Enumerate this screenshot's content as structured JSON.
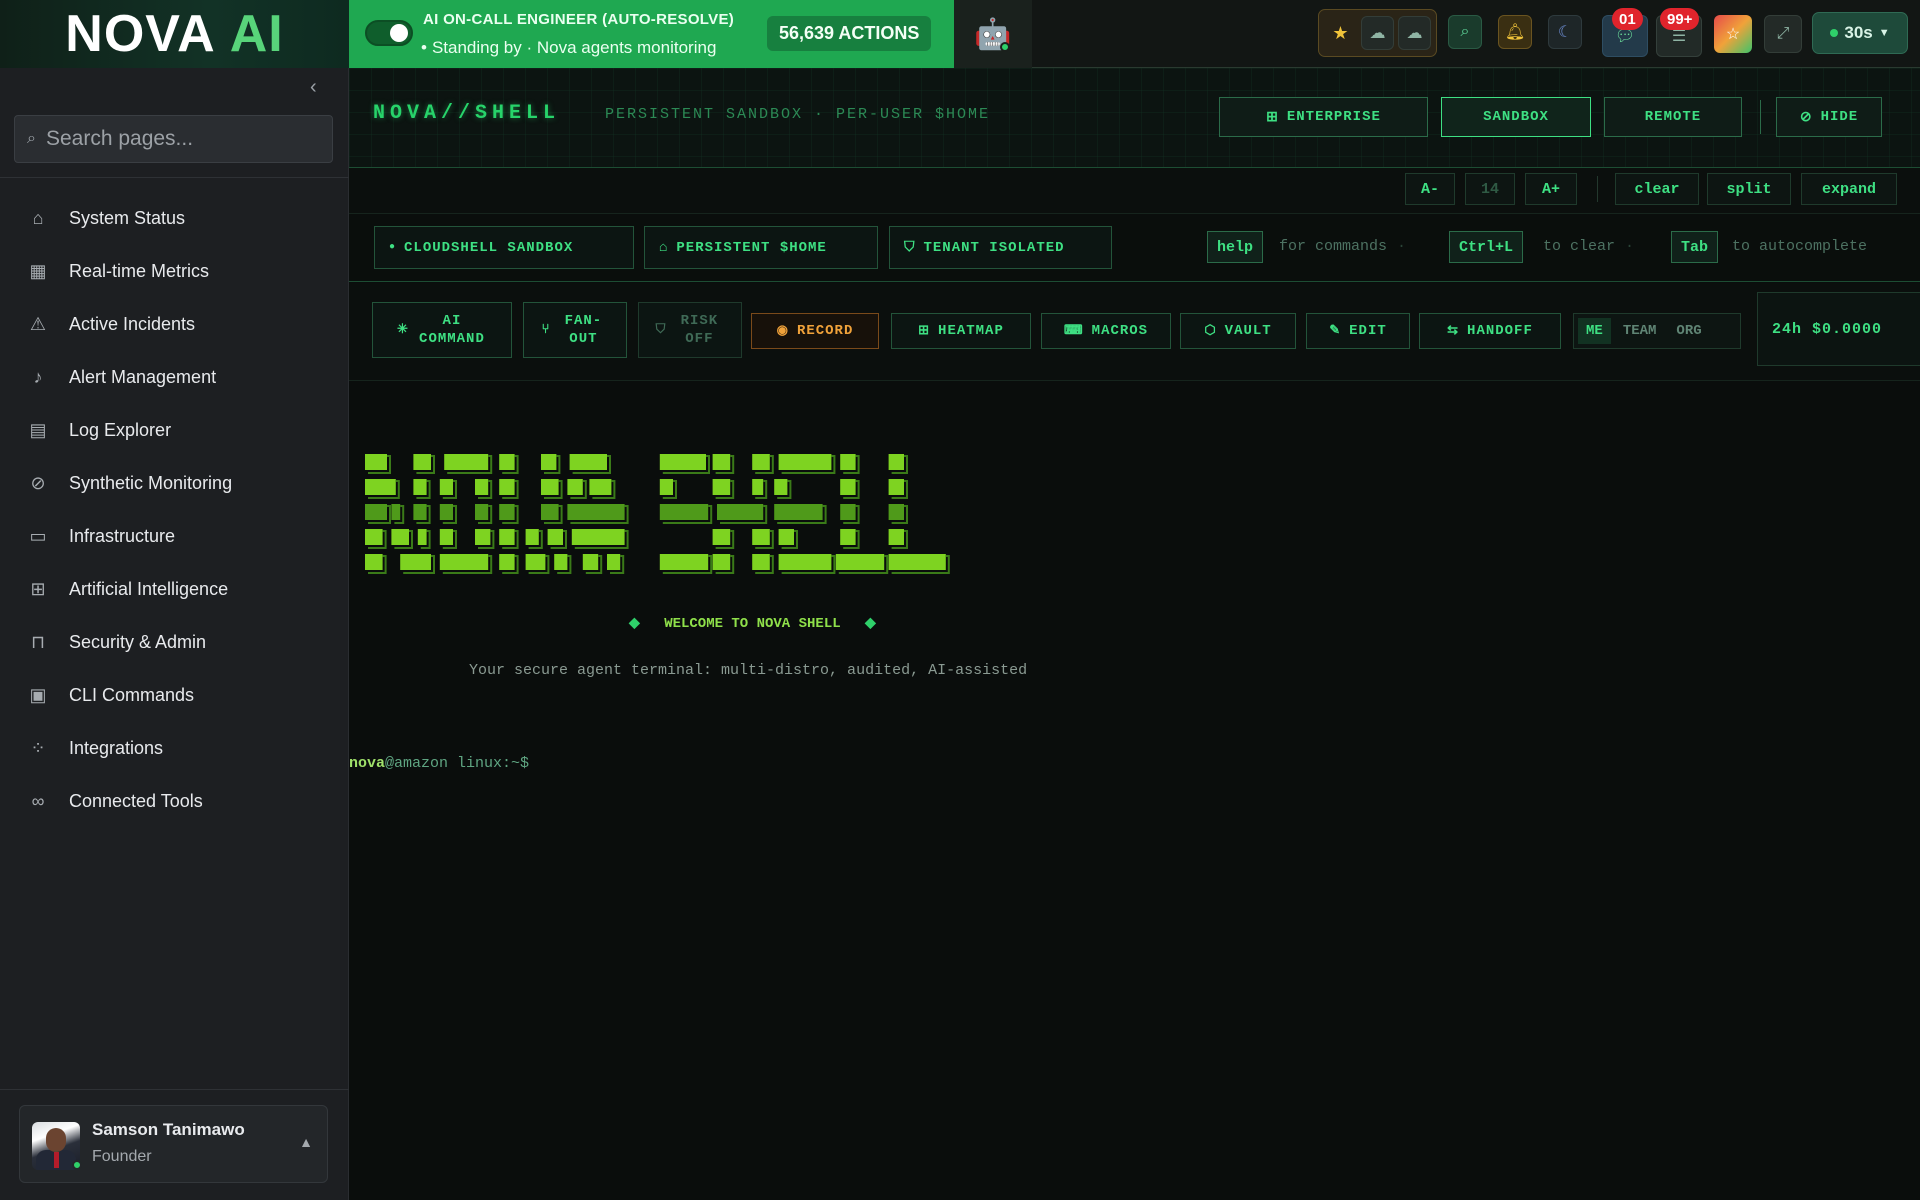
{
  "topbar": {
    "logo_a": "NOVA",
    "logo_b": "AI",
    "oncall_title": "AI ON-CALL ENGINEER (AUTO-RESOLVE)",
    "oncall_status": "Standing by · Nova agents monitoring",
    "actions_count": "56,639 ACTIONS",
    "badge_chat": "01",
    "badge_alerts": "99+",
    "refresh_label": "30s",
    "accent_color": "#1fa851"
  },
  "sidebar": {
    "search_placeholder": "Search pages...",
    "items": [
      {
        "label": "System Status",
        "icon": "home-icon"
      },
      {
        "label": "Real-time Metrics",
        "icon": "dashboard-icon"
      },
      {
        "label": "Active Incidents",
        "icon": "warning-icon"
      },
      {
        "label": "Alert Management",
        "icon": "bell-icon"
      },
      {
        "label": "Log Explorer",
        "icon": "clipboard-icon"
      },
      {
        "label": "Synthetic Monitoring",
        "icon": "eye-off-icon"
      },
      {
        "label": "Infrastructure",
        "icon": "server-icon"
      },
      {
        "label": "Artificial Intelligence",
        "icon": "cpu-icon"
      },
      {
        "label": "Security & Admin",
        "icon": "lock-icon"
      },
      {
        "label": "CLI Commands",
        "icon": "terminal-icon"
      },
      {
        "label": "Integrations",
        "icon": "grid-icon"
      },
      {
        "label": "Connected Tools",
        "icon": "link-icon"
      }
    ],
    "user": {
      "name": "Samson Tanimawo",
      "role": "Founder"
    }
  },
  "shell": {
    "title": "NOVA//SHELL",
    "subtitle": "PERSISTENT SANDBOX · PER-USER $HOME",
    "modes": [
      "ENTERPRISE",
      "SANDBOX",
      "REMOTE"
    ],
    "hide_label": "HIDE",
    "font_minus": "A-",
    "font_size": "14",
    "font_plus": "A+",
    "clear_label": "clear",
    "split_label": "split",
    "expand_label": "expand",
    "chips": [
      "CLOUDSHELL SANDBOX",
      "PERSISTENT $HOME",
      "TENANT ISOLATED"
    ],
    "hint_help_key": "help",
    "hint_help_text": "for commands",
    "hint_clear_key": "Ctrl+L",
    "hint_clear_text": "to clear",
    "hint_tab_key": "Tab",
    "hint_tab_text": "to autocomplete",
    "tools": {
      "ai_command": "AI COMMAND",
      "fan_out": "FAN-OUT",
      "risk_off": "RISK OFF",
      "record": "RECORD",
      "heatmap": "HEATMAP",
      "macros": "MACROS",
      "vault": "VAULT",
      "edit": "EDIT",
      "handoff": "HANDOFF"
    },
    "scope": [
      "ME",
      "TEAM",
      "ORG"
    ],
    "scope_selected": "ME",
    "cost": "24h $0.0000",
    "welcome": "WELCOME TO NOVA SHELL",
    "tagline": "Your secure agent terminal: multi-distro, audited, AI-assisted",
    "prompt_user": "nova",
    "prompt_host": "@amazon linux",
    "prompt_path": ":~$"
  }
}
